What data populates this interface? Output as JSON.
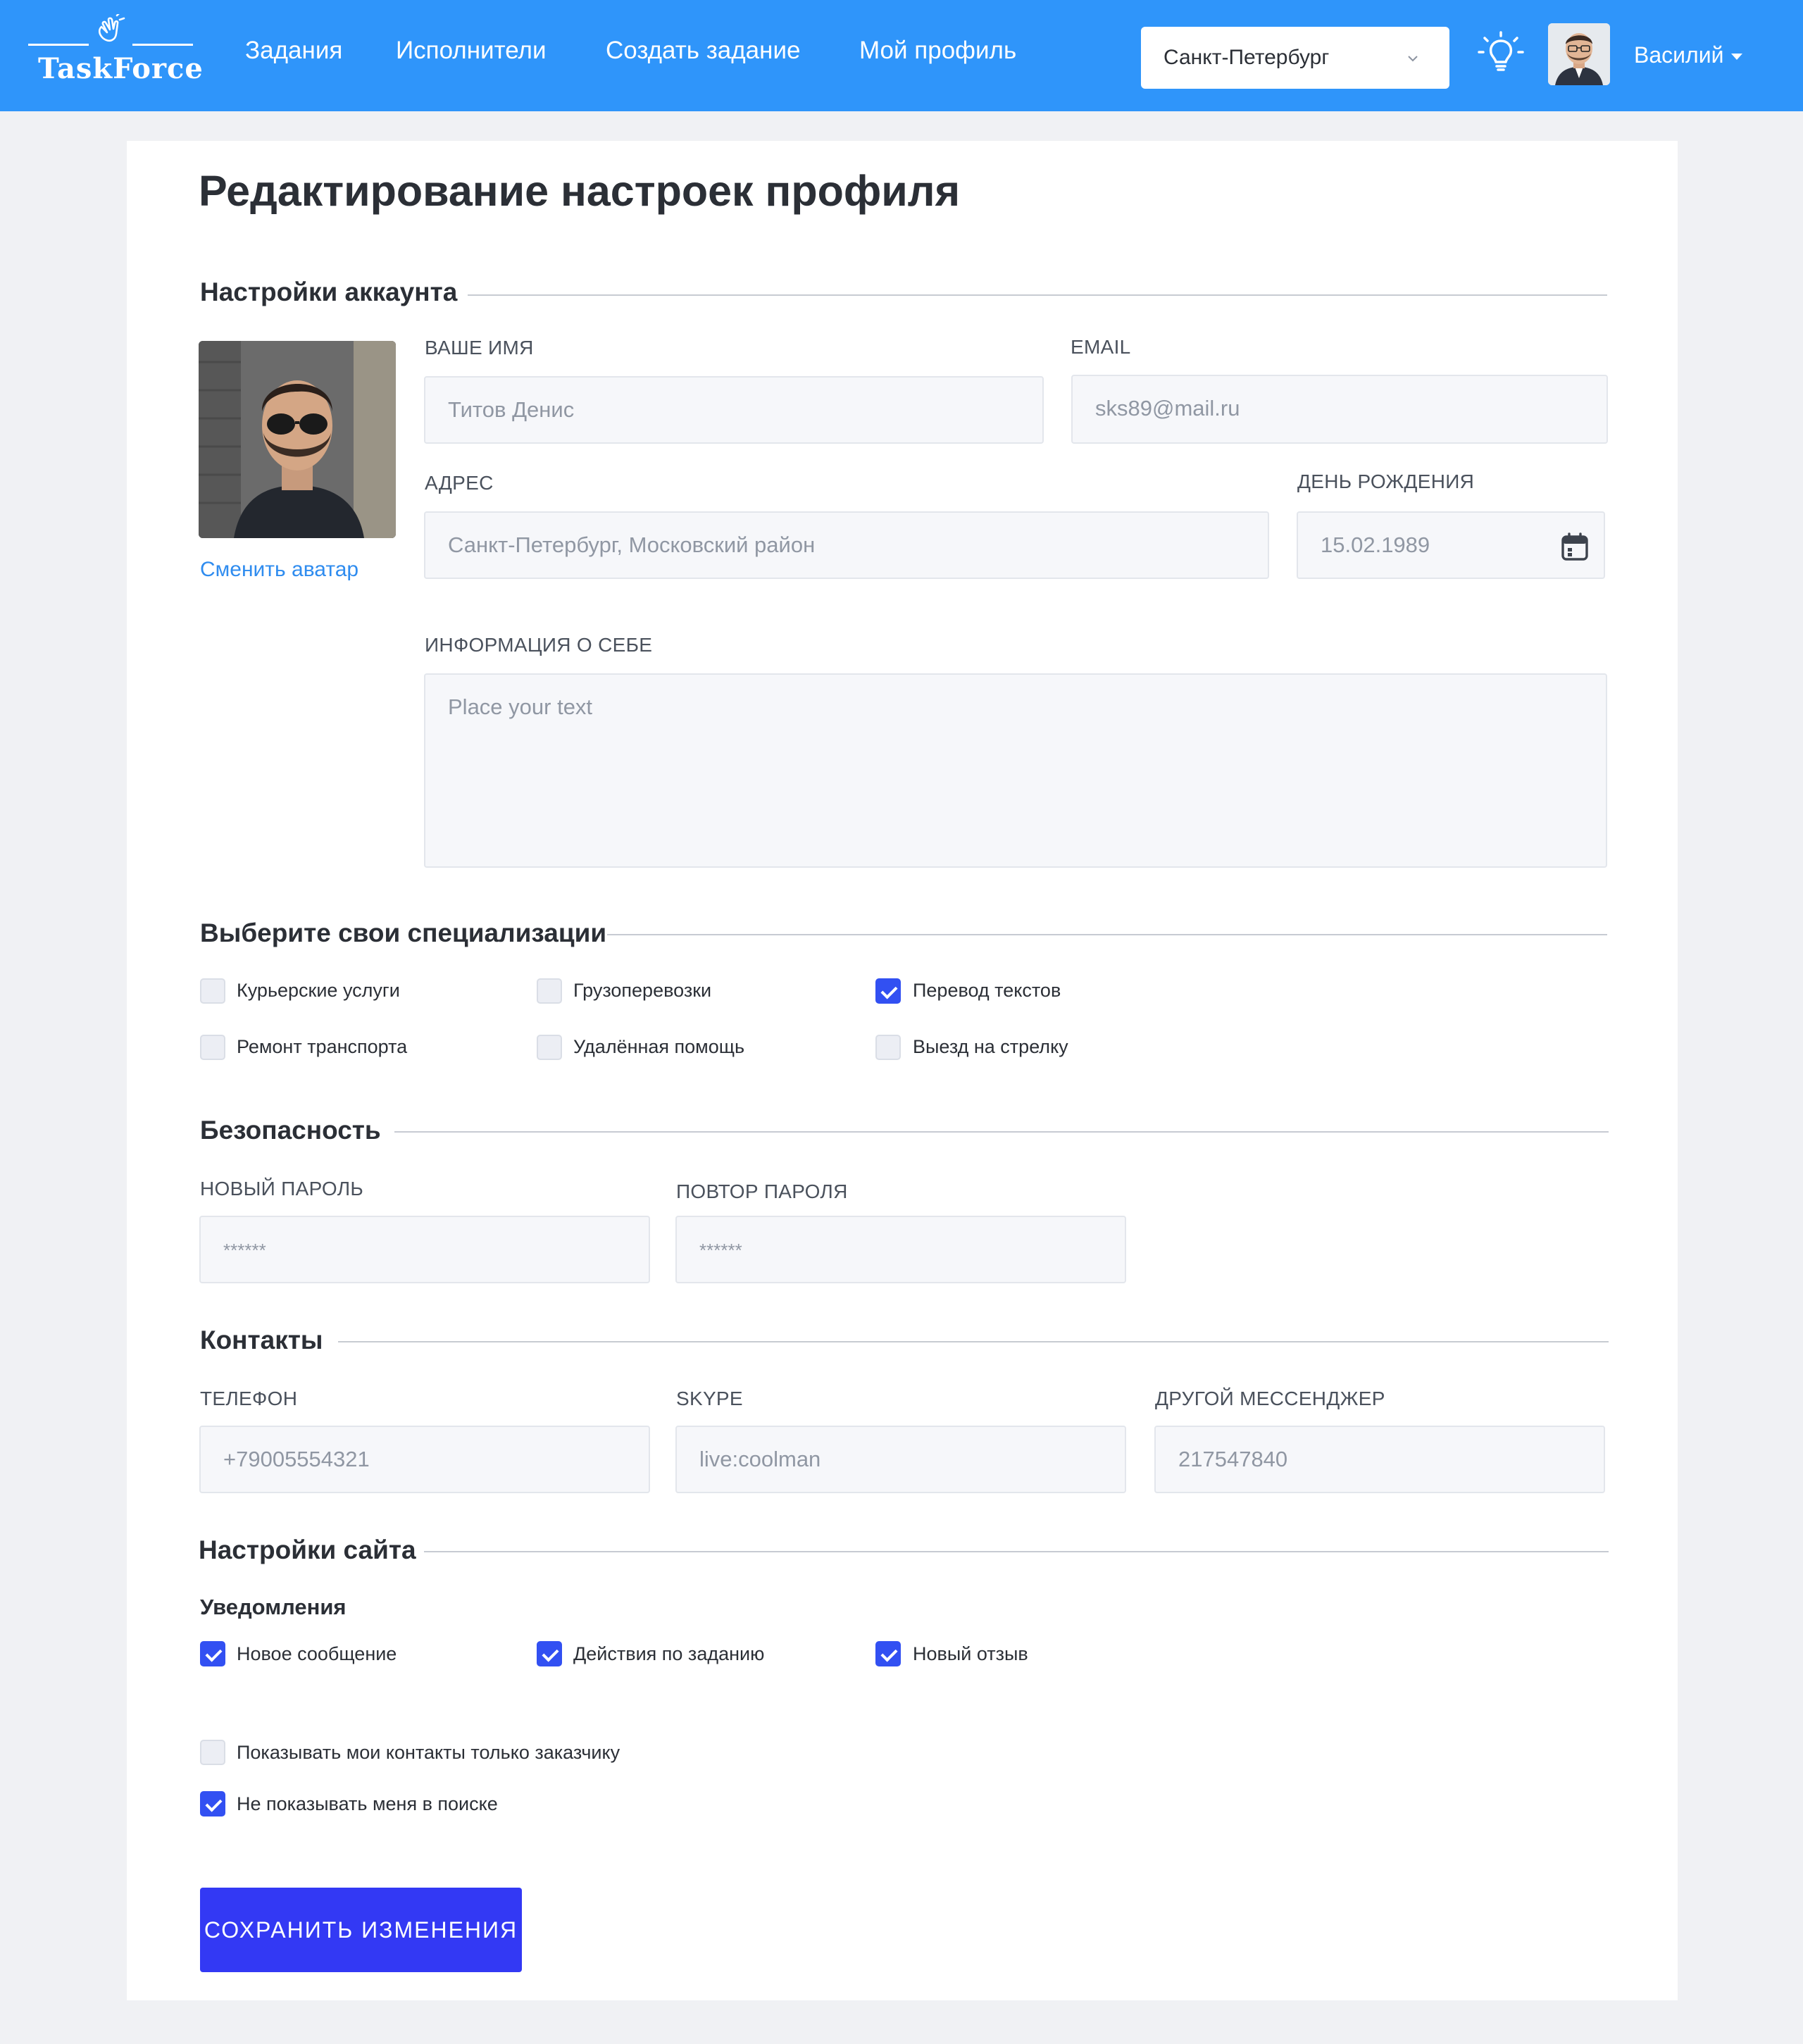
{
  "brand": {
    "name": "TaskForce"
  },
  "nav": [
    {
      "label": "Задания"
    },
    {
      "label": "Исполнители"
    },
    {
      "label": "Создать задание"
    },
    {
      "label": "Мой профиль"
    }
  ],
  "city": {
    "selected": "Санкт-Петербург"
  },
  "user": {
    "name": "Василий"
  },
  "page": {
    "title": "Редактирование настроек профиля"
  },
  "account": {
    "title": "Настройки аккаунта",
    "change_avatar": "Сменить аватар",
    "name_label": "ВАШЕ ИМЯ",
    "name_value": "Титов Денис",
    "email_label": "EMAIL",
    "email_value": "sks89@mail.ru",
    "address_label": "АДРЕС",
    "address_value": "Санкт-Петербург, Московский район",
    "birthday_label": "ДЕНЬ РОЖДЕНИЯ",
    "birthday_value": "15.02.1989",
    "about_label": "ИНФОРМАЦИЯ О СЕБЕ",
    "about_placeholder": "Place your text"
  },
  "specializations": {
    "title": "Выберите свои специализации",
    "items": [
      {
        "label": "Курьерские услуги",
        "checked": false
      },
      {
        "label": "Грузоперевозки",
        "checked": false
      },
      {
        "label": "Перевод текстов",
        "checked": true
      },
      {
        "label": "Ремонт транспорта",
        "checked": false
      },
      {
        "label": "Удалённая помощь",
        "checked": false
      },
      {
        "label": "Выезд на стрелку",
        "checked": false
      }
    ]
  },
  "security": {
    "title": "Безопасность",
    "new_password_label": "НОВЫЙ ПАРОЛЬ",
    "new_password_value": "******",
    "repeat_password_label": "ПОВТОР ПАРОЛЯ",
    "repeat_password_value": "******"
  },
  "contacts": {
    "title": "Контакты",
    "phone_label": "ТЕЛЕФОН",
    "phone_value": "+79005554321",
    "skype_label": "SKYPE",
    "skype_value": "live:coolman",
    "messenger_label": "ДРУГОЙ МЕССЕНДЖЕР",
    "messenger_value": "217547840"
  },
  "site_settings": {
    "title": "Настройки сайта",
    "notifications_title": "Уведомления",
    "notifications": [
      {
        "label": "Новое сообщение",
        "checked": true
      },
      {
        "label": "Действия по заданию",
        "checked": true
      },
      {
        "label": "Новый отзыв",
        "checked": true
      }
    ],
    "privacy": [
      {
        "label": "Показывать мои контакты только заказчику",
        "checked": false
      },
      {
        "label": "Не показывать меня в поиске",
        "checked": true
      }
    ]
  },
  "actions": {
    "save_label": "СОХРАНИТЬ ИЗМЕНЕНИЯ"
  },
  "colors": {
    "header": "#2f95fa",
    "accent": "#3339f4",
    "checkbox_on": "#3250f2",
    "link": "#2f8cef"
  }
}
